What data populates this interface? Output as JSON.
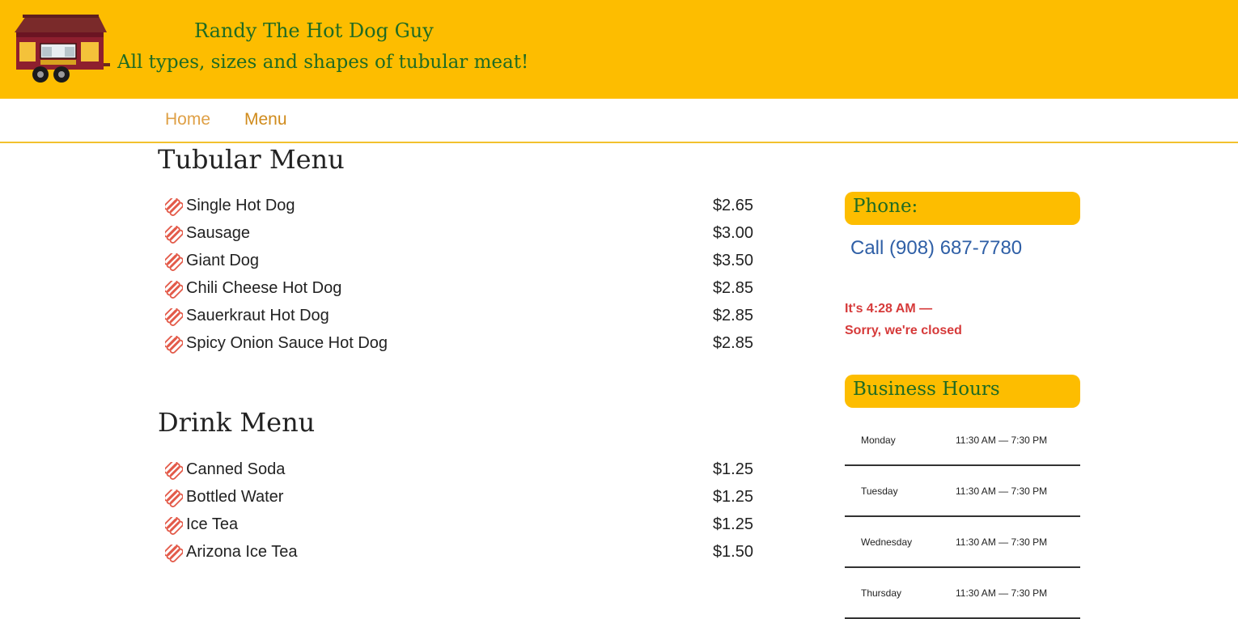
{
  "header": {
    "title": "Randy The Hot Dog Guy",
    "tagline": "All types, sizes and shapes of tubular meat!"
  },
  "nav": {
    "items": [
      {
        "label": "Home"
      },
      {
        "label": "Menu"
      }
    ]
  },
  "food_menu": {
    "title": "Tubular Menu",
    "items": [
      {
        "name": "Single Hot Dog",
        "price": "$2.65"
      },
      {
        "name": "Sausage",
        "price": "$3.00"
      },
      {
        "name": "Giant Dog",
        "price": "$3.50"
      },
      {
        "name": "Chili Cheese Hot Dog",
        "price": "$2.85"
      },
      {
        "name": "Sauerkraut Hot Dog",
        "price": "$2.85"
      },
      {
        "name": "Spicy Onion Sauce Hot Dog",
        "price": "$2.85"
      }
    ]
  },
  "drink_menu": {
    "title": "Drink Menu",
    "items": [
      {
        "name": "Canned Soda",
        "price": "$1.25"
      },
      {
        "name": "Bottled Water",
        "price": "$1.25"
      },
      {
        "name": "Ice Tea",
        "price": "$1.25"
      },
      {
        "name": "Arizona Ice Tea",
        "price": "$1.50"
      }
    ]
  },
  "sidebar": {
    "phone_heading": "Phone:",
    "phone_link": "Call (908) 687-7780",
    "status_time": "It's 4:28 AM —",
    "status_message": "Sorry, we're closed",
    "hours_heading": "Business Hours",
    "hours": [
      {
        "day": "Monday",
        "time": "11:30 AM — 7:30 PM"
      },
      {
        "day": "Tuesday",
        "time": "11:30 AM — 7:30 PM"
      },
      {
        "day": "Wednesday",
        "time": "11:30 AM — 7:30 PM"
      },
      {
        "day": "Thursday",
        "time": "11:30 AM — 7:30 PM"
      }
    ]
  },
  "colors": {
    "header_bg": "#fdbd00",
    "title_green": "#1f6b23",
    "link_blue": "#2f5fa6",
    "closed_red": "#d63a3a",
    "nav_orange": "#d08b1c"
  },
  "icons": {
    "logo": "food-truck-icon",
    "menu_bullet": "hot-dog-icon"
  }
}
